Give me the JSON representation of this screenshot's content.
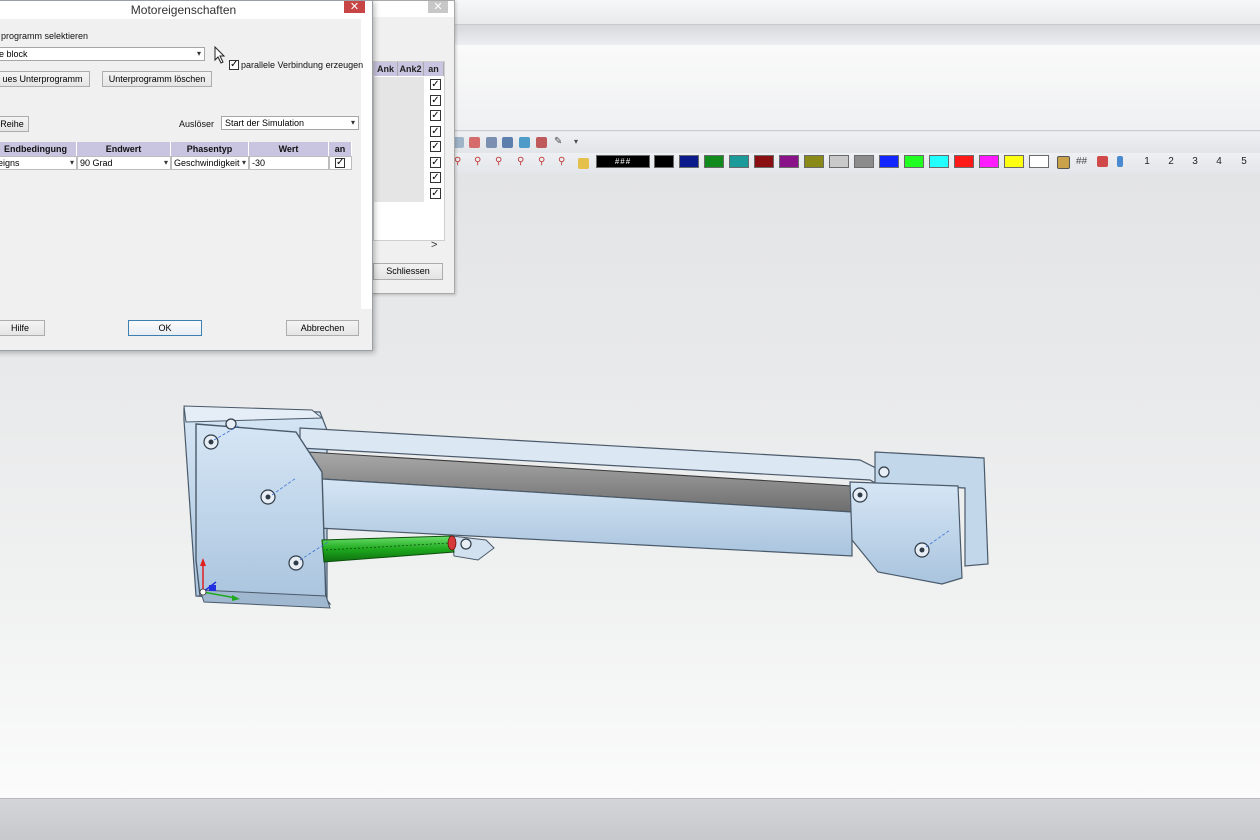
{
  "background_dialog": {
    "grid_headers": [
      "Ank",
      "Ank2",
      "an"
    ],
    "checked_rows": 8,
    "scroll_arrow": ">",
    "close_button": "Schliessen"
  },
  "toolbar": {
    "swatch_label": "###",
    "colors": [
      "#000000",
      "#000000",
      "#0a1a8a",
      "#118a1e",
      "#1a9a98",
      "#8a0f12",
      "#8a138a",
      "#8a8a18",
      "#c9c9c9",
      "#8c8c8c",
      "#1426ff",
      "#22ff22",
      "#22ffff",
      "#ff1a1a",
      "#ff1aff",
      "#ffff12",
      "#ffffff"
    ],
    "grid_glyph": "##",
    "view_numbers": [
      "1",
      "2",
      "3",
      "4",
      "5"
    ]
  },
  "dialog": {
    "title": "Motoreigenschaften",
    "close": "✕",
    "subprogram_label": "programm selektieren",
    "subprogram_value": "e block",
    "parallel_label": "parallele Verbindung erzeugen",
    "parallel_checked": true,
    "new_subprogram_button": "ues Unterprogramm",
    "delete_subprogram_button": "Unterprogramm löschen",
    "row_button": "Reihe",
    "trigger_label": "Auslöser",
    "trigger_value": "Start der Simulation",
    "grid": {
      "headers": [
        "Endbedingung",
        "Endwert",
        "Phasentyp",
        "Wert",
        "an"
      ],
      "row": [
        "eigns",
        "90 Grad",
        "Geschwindigkeit",
        "-30"
      ],
      "row_checked": true
    },
    "help_button": "Hilfe",
    "ok_button": "OK",
    "cancel_button": "Abbrechen"
  }
}
